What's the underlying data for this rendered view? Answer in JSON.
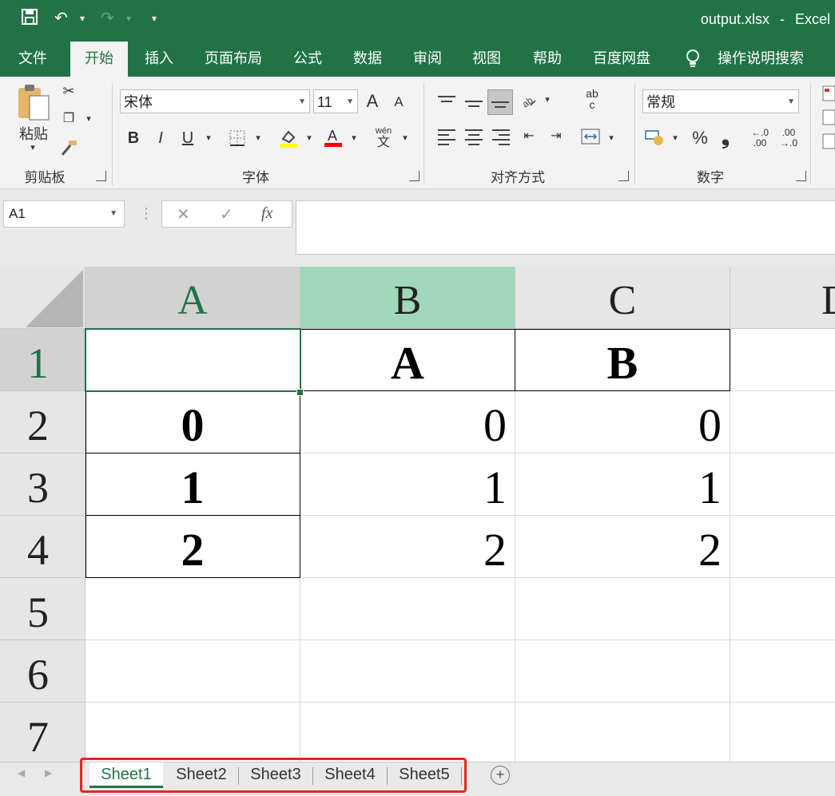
{
  "title_bar": {
    "file_title": "output.xlsx",
    "separator": "-",
    "app_name": "Excel",
    "save_icon": "save-icon",
    "undo_icon": "undo-icon",
    "redo_icon": "redo-icon",
    "customize_icon": "customize-quick-access-icon"
  },
  "ribbon_tabs": [
    "文件",
    "开始",
    "插入",
    "页面布局",
    "公式",
    "数据",
    "审阅",
    "视图",
    "帮助",
    "百度网盘"
  ],
  "active_tab": "开始",
  "tell_me": "操作说明搜索",
  "groups": {
    "clipboard": {
      "label": "剪贴板",
      "paste": "粘贴"
    },
    "font": {
      "label": "字体",
      "font_name": "宋体",
      "font_size": "11",
      "bold": "B",
      "italic": "I",
      "underline": "U",
      "grow": "A",
      "shrink": "A",
      "pinyin_top": "wén",
      "pinyin_bottom": "文"
    },
    "alignment": {
      "label": "对齐方式",
      "wrap_top": "ab",
      "wrap_bottom": "c"
    },
    "number": {
      "label": "数字",
      "format": "常规",
      "percent": "%",
      "comma": "❟",
      "inc_decimal_top": "←.0",
      "inc_decimal_bottom": ".00",
      "dec_decimal_top": ".00",
      "dec_decimal_bottom": "→.0"
    }
  },
  "formula_bar": {
    "name_box": "A1",
    "cancel": "✕",
    "enter": "✓",
    "fx": "fx",
    "formula": ""
  },
  "columns": [
    "A",
    "B",
    "C",
    "D"
  ],
  "rows": [
    "1",
    "2",
    "3",
    "4",
    "5",
    "6",
    "7"
  ],
  "cells": {
    "r1": [
      "",
      "A",
      "B"
    ],
    "r2": [
      "0",
      "0",
      "0"
    ],
    "r3": [
      "1",
      "1",
      "1"
    ],
    "r4": [
      "2",
      "2",
      "2"
    ]
  },
  "sheets": [
    "Sheet1",
    "Sheet2",
    "Sheet3",
    "Sheet4",
    "Sheet5"
  ],
  "active_sheet": "Sheet1",
  "colors": {
    "excel_green": "#217346",
    "highlight": "#ff0000",
    "selected_col_header": "#a0d8b9"
  }
}
